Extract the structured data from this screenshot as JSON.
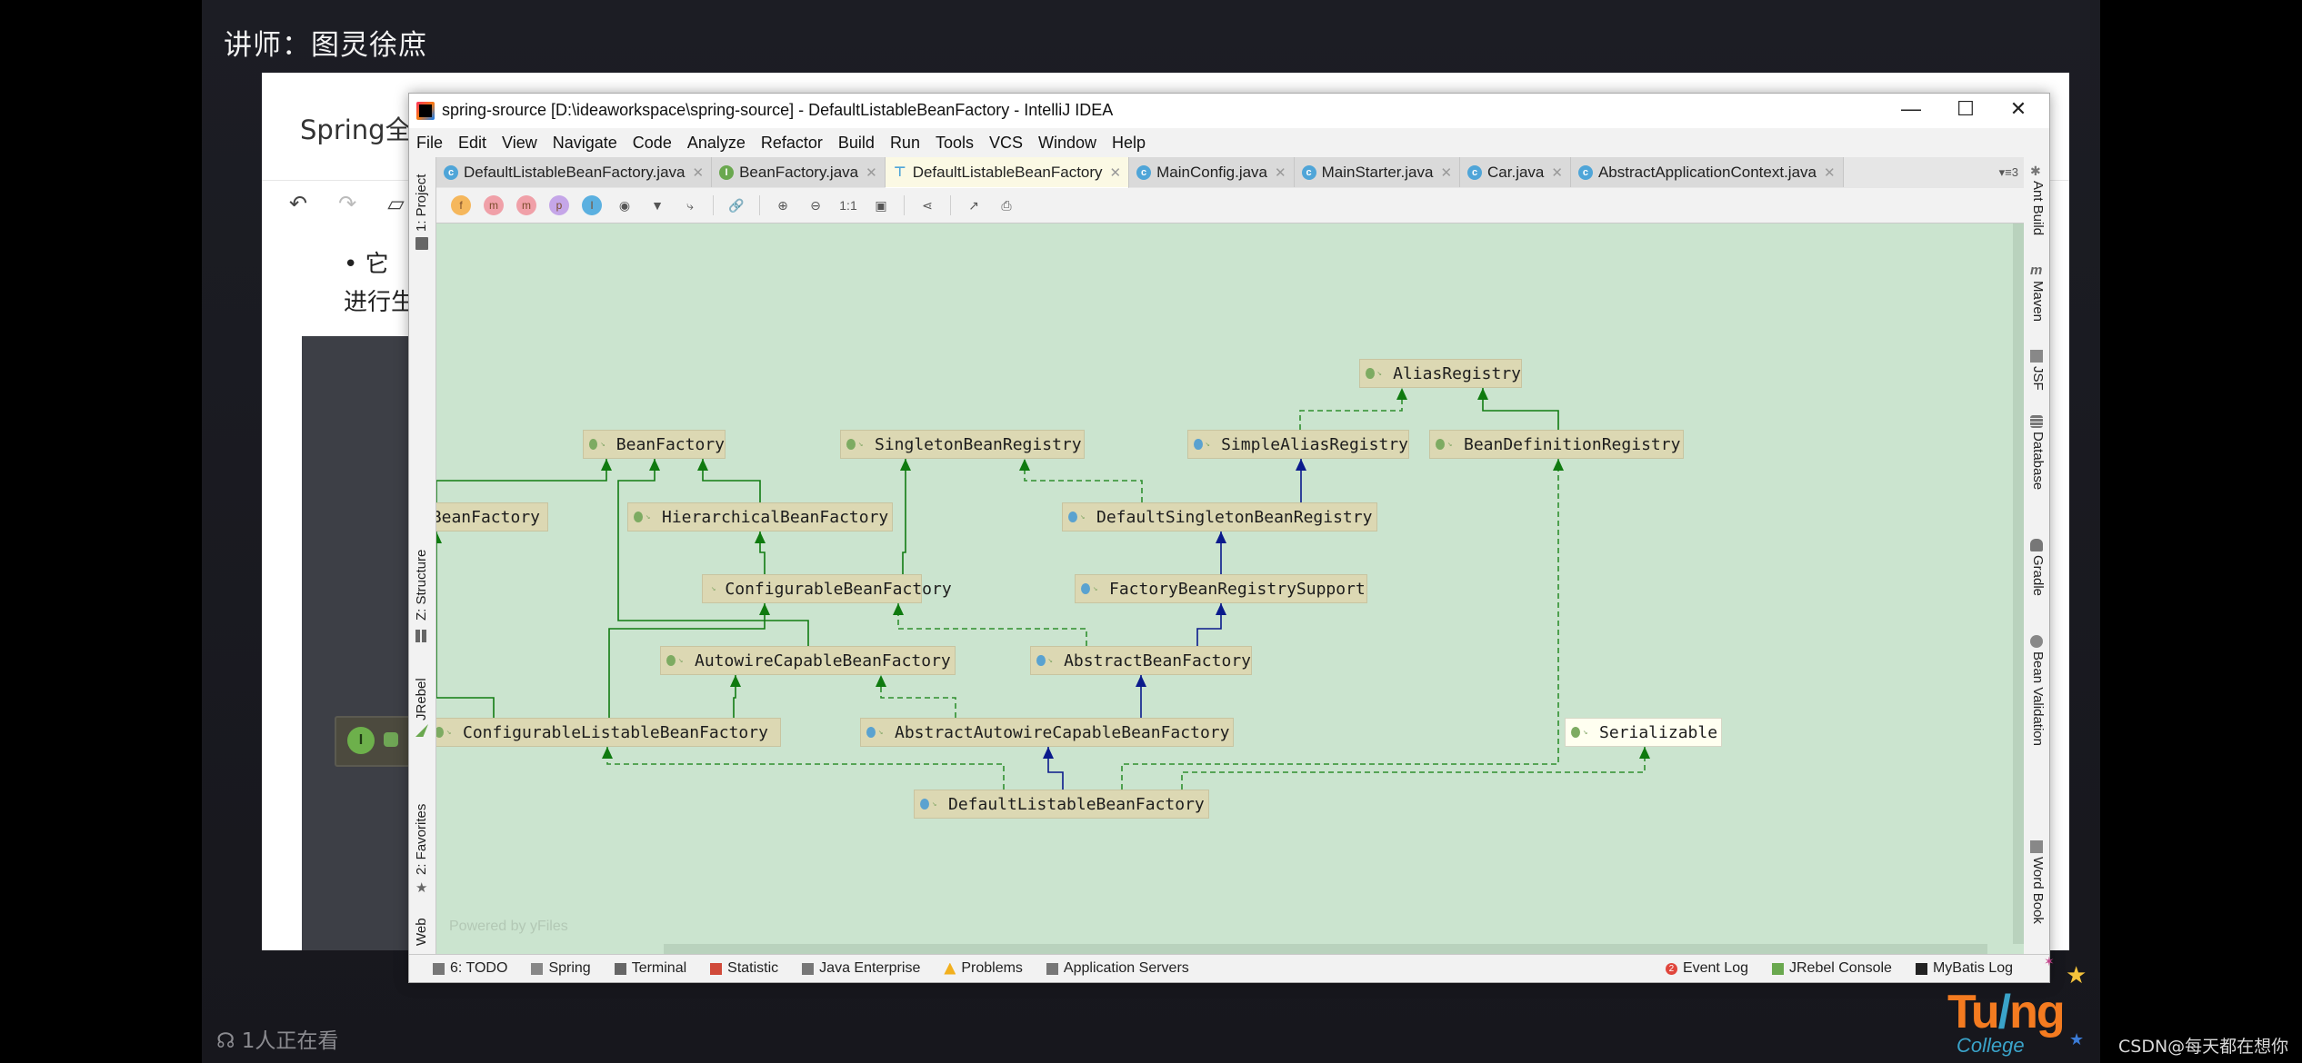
{
  "video": {
    "lecturer": "讲师：图灵徐庶",
    "watching": "1人正在看",
    "watermark": "CSDN@每天都在想你",
    "logo": {
      "main_a": "Tu",
      "slash": "/",
      "main_b": "ng",
      "sub": "College"
    }
  },
  "background_doc": {
    "title": "Spring全家",
    "bullet_line1": "•    它",
    "bullet_line2": "进行生"
  },
  "ide": {
    "window_title": "spring-srource [D:\\ideaworkspace\\spring-source] - DefaultListableBeanFactory - IntelliJ IDEA",
    "window_controls": {
      "minimize": "—",
      "maximize": "☐",
      "close": "✕"
    },
    "menu": [
      "File",
      "Edit",
      "View",
      "Navigate",
      "Code",
      "Analyze",
      "Refactor",
      "Build",
      "Run",
      "Tools",
      "VCS",
      "Window",
      "Help"
    ],
    "tabs": [
      {
        "label": "DefaultListableBeanFactory.java",
        "icon": "class-icon",
        "icon_letter": "c",
        "color": "#4fa5d8",
        "active": false
      },
      {
        "label": "BeanFactory.java",
        "icon": "interface-icon",
        "icon_letter": "I",
        "color": "#6aa84f",
        "active": false
      },
      {
        "label": "DefaultListableBeanFactory",
        "icon": "diagram-icon",
        "icon_letter": "⊤",
        "color": "#4fa5d8",
        "active": true
      },
      {
        "label": "MainConfig.java",
        "icon": "class-icon",
        "icon_letter": "c",
        "color": "#4fa5d8",
        "active": false
      },
      {
        "label": "MainStarter.java",
        "icon": "runnable-class-icon",
        "icon_letter": "c",
        "color": "#4fa5d8",
        "active": false
      },
      {
        "label": "Car.java",
        "icon": "class-icon",
        "icon_letter": "c",
        "color": "#4fa5d8",
        "active": false
      },
      {
        "label": "AbstractApplicationContext.java",
        "icon": "abstract-class-icon",
        "icon_letter": "c",
        "color": "#4fa5d8",
        "active": false
      }
    ],
    "tabs_overflow": "▾≡3",
    "toolbar": [
      {
        "name": "fields-toggle",
        "glyph": "f",
        "color": "#f5b75c"
      },
      {
        "name": "constructors-toggle",
        "glyph": "m",
        "color": "#f0a0a8"
      },
      {
        "name": "methods-toggle",
        "glyph": "m",
        "color": "#f0a0a8"
      },
      {
        "name": "properties-toggle",
        "glyph": "p",
        "color": "#c5a6e8"
      },
      {
        "name": "inner-classes-toggle",
        "glyph": "I",
        "color": "#5bb0e0"
      },
      {
        "name": "visibility-filter",
        "glyph": "◉",
        "color": ""
      },
      {
        "name": "filter",
        "glyph": "▼",
        "color": ""
      },
      {
        "name": "edge-mode",
        "glyph": "⤷",
        "color": ""
      },
      {
        "name": "dependencies",
        "glyph": "🔗",
        "color": ""
      },
      {
        "name": "zoom-in",
        "glyph": "⊕",
        "color": ""
      },
      {
        "name": "zoom-out",
        "glyph": "⊖",
        "color": ""
      },
      {
        "name": "actual-size",
        "glyph": "1:1",
        "color": ""
      },
      {
        "name": "fit-content",
        "glyph": "▣",
        "color": ""
      },
      {
        "name": "layout",
        "glyph": "⋖",
        "color": ""
      },
      {
        "name": "export",
        "glyph": "↗",
        "color": ""
      },
      {
        "name": "print",
        "glyph": "⎙",
        "color": ""
      }
    ],
    "left_tool_windows": [
      "1: Project",
      "Z: Structure",
      "JRebel",
      "2: Favorites",
      "Web"
    ],
    "right_tool_windows": [
      "Ant Build",
      "Maven",
      "JSF",
      "Database",
      "Gradle",
      "Bean Validation",
      "Word Book"
    ],
    "diagram": {
      "watermark": "Powered by yFiles",
      "background": "#cbe4cf",
      "node_fill": "#dcd8b3",
      "nodes": [
        {
          "id": "AliasRegistry",
          "label": "AliasRegistry",
          "kind": "interface"
        },
        {
          "id": "SimpleAliasRegistry",
          "label": "SimpleAliasRegistry",
          "kind": "class"
        },
        {
          "id": "BeanDefinitionRegistry",
          "label": "BeanDefinitionRegistry",
          "kind": "interface"
        },
        {
          "id": "BeanFactory",
          "label": "BeanFactory",
          "kind": "interface"
        },
        {
          "id": "SingletonBeanRegistry",
          "label": "SingletonBeanRegistry",
          "kind": "interface"
        },
        {
          "id": "ListableBeanFactory",
          "label": "BeanFactory",
          "kind": "interface"
        },
        {
          "id": "HierarchicalBeanFactory",
          "label": "HierarchicalBeanFactory",
          "kind": "interface"
        },
        {
          "id": "DefaultSingletonBeanRegistry",
          "label": "DefaultSingletonBeanRegistry",
          "kind": "class"
        },
        {
          "id": "ConfigurableBeanFactory",
          "label": "ConfigurableBeanFactory",
          "kind": "interface"
        },
        {
          "id": "FactoryBeanRegistrySupport",
          "label": "FactoryBeanRegistrySupport",
          "kind": "class"
        },
        {
          "id": "AutowireCapableBeanFactory",
          "label": "AutowireCapableBeanFactory",
          "kind": "interface"
        },
        {
          "id": "AbstractBeanFactory",
          "label": "AbstractBeanFactory",
          "kind": "class"
        },
        {
          "id": "ConfigurableListableBeanFactory",
          "label": "ConfigurableListableBeanFactory",
          "kind": "interface"
        },
        {
          "id": "AbstractAutowireCapableBeanFactory",
          "label": "AbstractAutowireCapableBeanFactory",
          "kind": "class"
        },
        {
          "id": "Serializable",
          "label": "Serializable",
          "kind": "interface"
        },
        {
          "id": "DefaultListableBeanFactory",
          "label": "DefaultListableBeanFactory",
          "kind": "class"
        }
      ],
      "edges": [
        {
          "from": "SimpleAliasRegistry",
          "to": "AliasRegistry",
          "type": "implements"
        },
        {
          "from": "BeanDefinitionRegistry",
          "to": "AliasRegistry",
          "type": "extends-interface"
        },
        {
          "from": "DefaultSingletonBeanRegistry",
          "to": "SimpleAliasRegistry",
          "type": "extends-class"
        },
        {
          "from": "DefaultSingletonBeanRegistry",
          "to": "SingletonBeanRegistry",
          "type": "implements"
        },
        {
          "from": "FactoryBeanRegistrySupport",
          "to": "DefaultSingletonBeanRegistry",
          "type": "extends-class"
        },
        {
          "from": "ListableBeanFactory",
          "to": "BeanFactory",
          "type": "extends-interface"
        },
        {
          "from": "HierarchicalBeanFactory",
          "to": "BeanFactory",
          "type": "extends-interface"
        },
        {
          "from": "AutowireCapableBeanFactory",
          "to": "BeanFactory",
          "type": "extends-interface"
        },
        {
          "from": "ConfigurableBeanFactory",
          "to": "HierarchicalBeanFactory",
          "type": "extends-interface"
        },
        {
          "from": "ConfigurableBeanFactory",
          "to": "SingletonBeanRegistry",
          "type": "extends-interface"
        },
        {
          "from": "AbstractBeanFactory",
          "to": "ConfigurableBeanFactory",
          "type": "implements"
        },
        {
          "from": "AbstractBeanFactory",
          "to": "FactoryBeanRegistrySupport",
          "type": "extends-class"
        },
        {
          "from": "ConfigurableListableBeanFactory",
          "to": "ListableBeanFactory",
          "type": "extends-interface"
        },
        {
          "from": "ConfigurableListableBeanFactory",
          "to": "AutowireCapableBeanFactory",
          "type": "extends-interface"
        },
        {
          "from": "ConfigurableListableBeanFactory",
          "to": "ConfigurableBeanFactory",
          "type": "extends-interface"
        },
        {
          "from": "AbstractAutowireCapableBeanFactory",
          "to": "AutowireCapableBeanFactory",
          "type": "implements"
        },
        {
          "from": "AbstractAutowireCapableBeanFactory",
          "to": "AbstractBeanFactory",
          "type": "extends-class"
        },
        {
          "from": "DefaultListableBeanFactory",
          "to": "AbstractAutowireCapableBeanFactory",
          "type": "extends-class"
        },
        {
          "from": "DefaultListableBeanFactory",
          "to": "ConfigurableListableBeanFactory",
          "type": "implements"
        },
        {
          "from": "DefaultListableBeanFactory",
          "to": "BeanDefinitionRegistry",
          "type": "implements"
        },
        {
          "from": "DefaultListableBeanFactory",
          "to": "Serializable",
          "type": "implements"
        }
      ],
      "edge_colors": {
        "extends-interface": "#127c12",
        "implements": "#2f8f2f",
        "extends-class": "#0a1a8c"
      }
    },
    "status_bar": {
      "left": [
        {
          "label": "6: TODO",
          "icon": "todo-icon"
        },
        {
          "label": "Spring",
          "icon": "spring-leaf-icon"
        },
        {
          "label": "Terminal",
          "icon": "terminal-icon"
        },
        {
          "label": "Statistic",
          "icon": "statistic-icon"
        },
        {
          "label": "Java Enterprise",
          "icon": "java-enterprise-icon"
        },
        {
          "label": "Problems",
          "icon": "warning-icon"
        },
        {
          "label": "Application Servers",
          "icon": "app-servers-icon"
        }
      ],
      "right": [
        {
          "label": "Event Log",
          "icon": "event-log-icon",
          "badge": "2"
        },
        {
          "label": "JRebel Console",
          "icon": "jrebel-icon"
        },
        {
          "label": "MyBatis Log",
          "icon": "mybatis-icon"
        }
      ]
    }
  }
}
